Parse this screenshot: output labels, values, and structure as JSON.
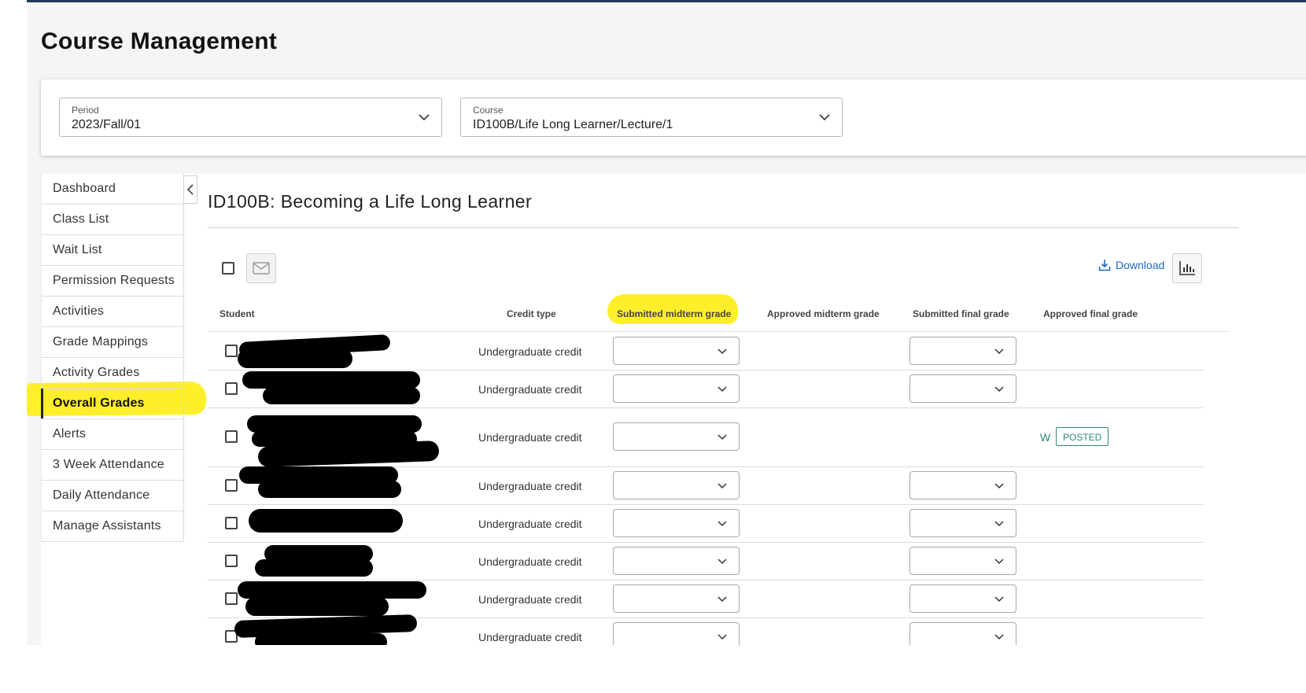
{
  "page": {
    "title": "Course Management"
  },
  "filters": {
    "period": {
      "label": "Period",
      "value": "2023/Fall/01"
    },
    "course": {
      "label": "Course",
      "value": "ID100B/Life Long Learner/Lecture/1"
    }
  },
  "sidebar": {
    "items": [
      {
        "label": "Dashboard"
      },
      {
        "label": "Class List"
      },
      {
        "label": "Wait List"
      },
      {
        "label": "Permission Requests"
      },
      {
        "label": "Activities"
      },
      {
        "label": "Grade Mappings"
      },
      {
        "label": "Activity Grades"
      },
      {
        "label": "Overall Grades",
        "active": true
      },
      {
        "label": "Alerts"
      },
      {
        "label": "3 Week Attendance"
      },
      {
        "label": "Daily Attendance"
      },
      {
        "label": "Manage Assistants"
      }
    ]
  },
  "main": {
    "heading": "ID100B: Becoming a Life Long Learner",
    "toolbar": {
      "download_label": "Download"
    }
  },
  "table": {
    "columns": {
      "student": "Student",
      "credit_type": "Credit type",
      "submitted_midterm": "Submitted midterm grade",
      "approved_midterm": "Approved midterm grade",
      "submitted_final": "Submitted final grade",
      "approved_final": "Approved final grade"
    },
    "rows": [
      {
        "credit_type": "Undergraduate credit",
        "submitted_midterm": "",
        "submitted_final": "",
        "approved_final": ""
      },
      {
        "credit_type": "Undergraduate credit",
        "submitted_midterm": "",
        "submitted_final": "",
        "approved_final": ""
      },
      {
        "credit_type": "Undergraduate credit",
        "submitted_midterm": "",
        "submitted_final": null,
        "approved_final": "W",
        "approved_final_status": "POSTED"
      },
      {
        "credit_type": "Undergraduate credit",
        "submitted_midterm": "",
        "submitted_final": "",
        "approved_final": ""
      },
      {
        "credit_type": "Undergraduate credit",
        "submitted_midterm": "",
        "submitted_final": "",
        "approved_final": ""
      },
      {
        "credit_type": "Undergraduate credit",
        "submitted_midterm": "",
        "submitted_final": "",
        "approved_final": ""
      },
      {
        "credit_type": "Undergraduate credit",
        "submitted_midterm": "",
        "submitted_final": "",
        "approved_final": ""
      },
      {
        "credit_type": "Undergraduate credit",
        "submitted_midterm": "",
        "submitted_final": "",
        "approved_final": ""
      }
    ]
  },
  "colors": {
    "accent": "#1f67b8",
    "status_posted": "#2a8a78",
    "highlight": "#ffef2a",
    "top_bar": "#1e3a5f"
  },
  "icons": {
    "period_dropdown": "chevron-down-icon",
    "course_dropdown": "chevron-down-icon",
    "collapse": "chevron-left-icon",
    "email": "mail-icon",
    "download": "download-icon",
    "statistics": "bar-chart-icon"
  }
}
